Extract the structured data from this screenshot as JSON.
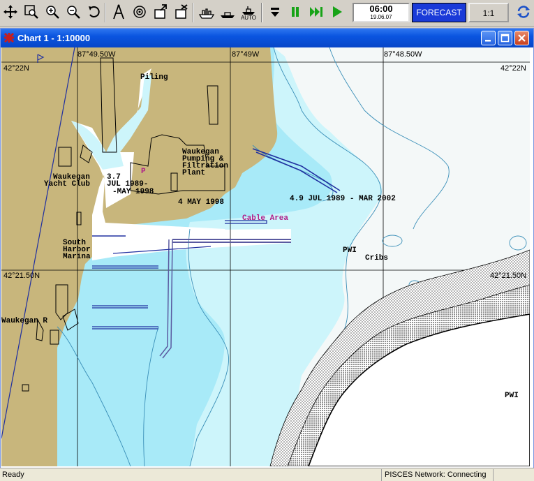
{
  "toolbar": {
    "buttons": [
      {
        "name": "pan-arrows-icon"
      },
      {
        "name": "zoom-box-icon"
      },
      {
        "name": "zoom-in-icon"
      },
      {
        "name": "zoom-out-icon"
      },
      {
        "name": "undo-view-icon"
      },
      {
        "name": "compass-icon"
      },
      {
        "name": "target-icon"
      },
      {
        "name": "chart-import-icon"
      },
      {
        "name": "chart-delete-icon"
      },
      {
        "name": "ship-view-icon"
      },
      {
        "name": "ship-course-icon"
      },
      {
        "name": "ship-auto-icon",
        "label": "AUTO"
      },
      {
        "name": "stop-icon"
      },
      {
        "name": "pause-icon"
      },
      {
        "name": "fast-forward-icon"
      },
      {
        "name": "play-icon"
      }
    ],
    "clock": {
      "time": "06:00",
      "date": "19.06.07"
    },
    "forecast_label": "FORECAST",
    "scale_label": "1:1",
    "sync_icon": "refresh-icon"
  },
  "window": {
    "title": "Chart 1 - 1:10000",
    "buttons": [
      "minimize-icon",
      "maximize-icon",
      "close-icon"
    ]
  },
  "map": {
    "coords": {
      "lon_left": "87°49.50W",
      "lon_mid": "87°49W",
      "lon_right": "87°48.50W",
      "lat_top_left": "42°22N",
      "lat_top_right": "42°22N",
      "lat_mid_left": "42°21.50N",
      "lat_mid_right": "42°21.50N"
    },
    "labels": {
      "piling": "Piling",
      "waukegan_pumping_1": "Waukegan",
      "waukegan_pumping_2": "Pumping &",
      "waukegan_pumping_3": "Filtration",
      "waukegan_pumping_4": "Plant",
      "yacht_club_1": "Waukegan",
      "yacht_club_2": "Yacht Club",
      "depth_37": "3.7",
      "jul_1989": "JUL 1989-",
      "may_1998_a": "-MAY 1998",
      "p_marker": "P",
      "may_1998_b": "4  MAY 1998",
      "depth_49": "4.9  JUL 1989 - MAR 2002",
      "cable_area": "Cable Area",
      "south_harbor_1": "South",
      "south_harbor_2": "Harbor",
      "south_harbor_3": "Marina",
      "pwi_1": "PWI",
      "cribs": "Cribs",
      "waukegan_r": "Waukegan R",
      "pwi_2": "PWI"
    },
    "colors": {
      "land": "#c8b67c",
      "shallow": "#a8eaf8",
      "deep": "#cdf5fb",
      "white_water": "#f5f8f8",
      "dredged": "#ffffff"
    }
  },
  "status": {
    "left": "Ready",
    "network": "PISCES Network: Connecting"
  }
}
